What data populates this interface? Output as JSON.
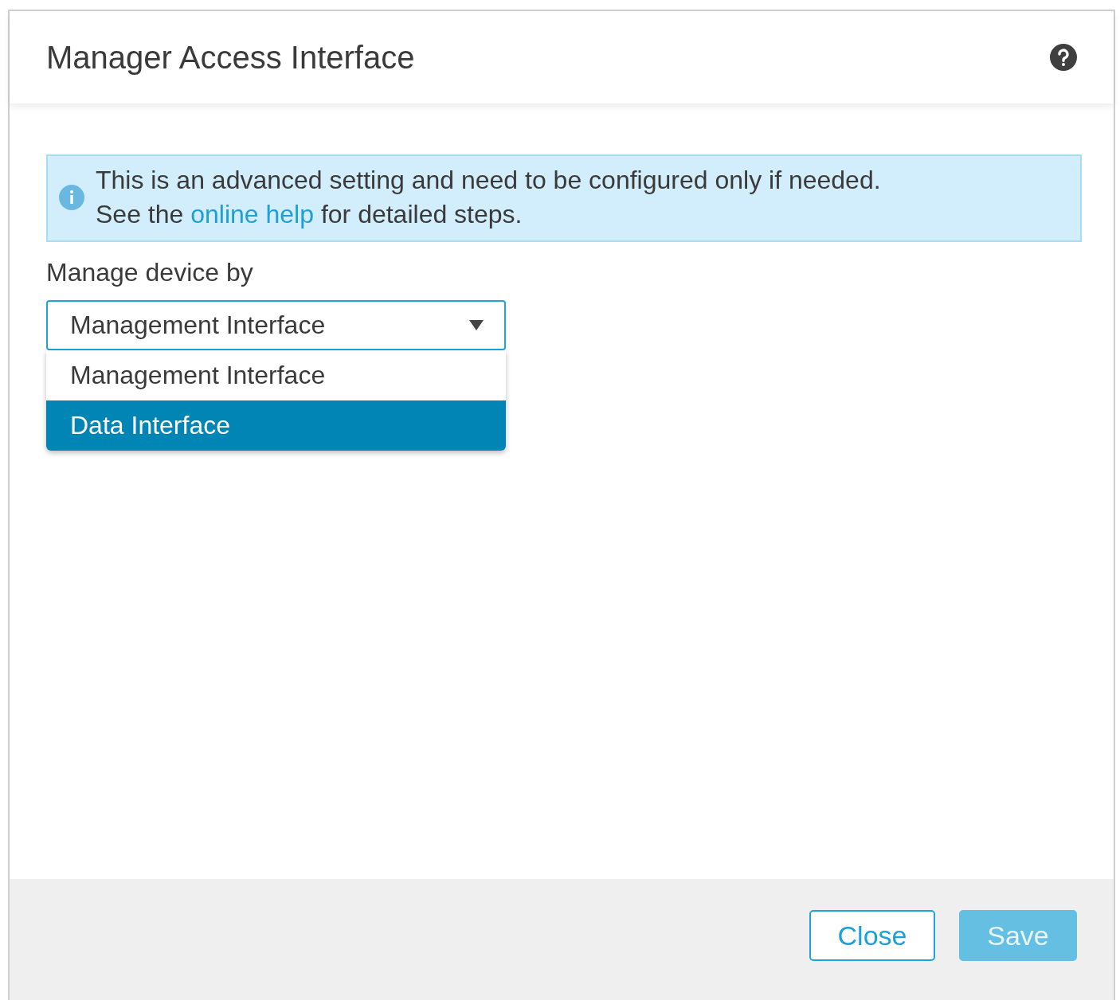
{
  "dialog": {
    "title": "Manager Access Interface"
  },
  "info": {
    "line_1": "This is an advanced setting and need to be configured only if needed.",
    "before_link": "See the",
    "link": "online help",
    "after_link": "for detailed steps."
  },
  "field": {
    "label": "Manage device by",
    "value": "Management Interface",
    "expanded": true,
    "options": [
      {
        "label": "Management Interface",
        "highlighted": false
      },
      {
        "label": "Data Interface",
        "highlighted": true
      }
    ]
  },
  "buttons": [
    {
      "label": "Close",
      "kind": "secondary",
      "disabled": false
    },
    {
      "label": "Save",
      "kind": "primary",
      "disabled": true
    }
  ]
}
